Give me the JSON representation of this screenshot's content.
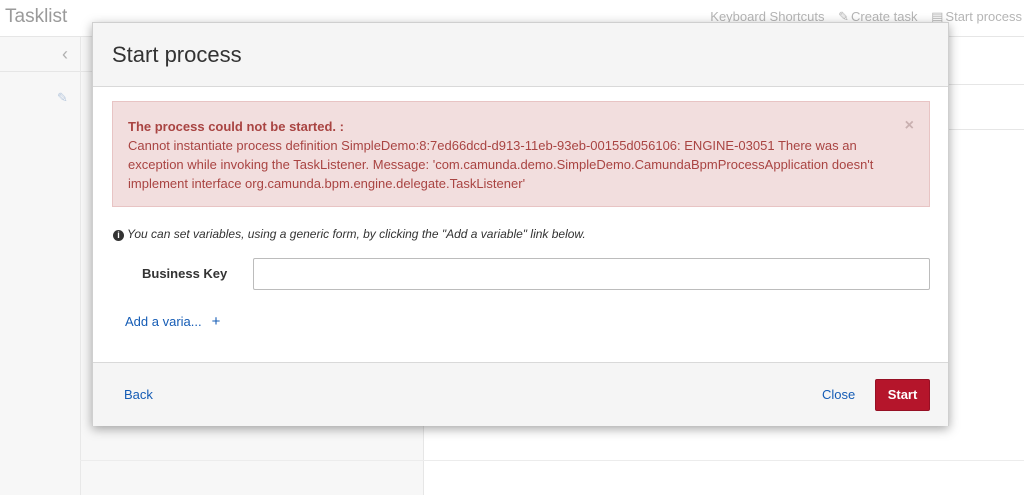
{
  "app": {
    "title": "Tasklist",
    "nav": {
      "shortcuts": "Keyboard Shortcuts",
      "create_task": "Create task",
      "start_process": "Start process"
    }
  },
  "modal": {
    "title": "Start process",
    "alert": {
      "title": "The process could not be started. :",
      "message": "Cannot instantiate process definition SimpleDemo:8:7ed66dcd-d913-11eb-93eb-00155d056106: ENGINE-03051 There was an exception while invoking the TaskListener. Message: 'com.camunda.demo.SimpleDemo.CamundaBpmProcessApplication doesn't implement interface org.camunda.bpm.engine.delegate.TaskListener'",
      "close_glyph": "×"
    },
    "hint": "You can set variables, using a generic form, by clicking the \"Add a variable\" link below.",
    "business_key": {
      "label": "Business Key",
      "value": ""
    },
    "add_variable": {
      "label": "Add a varia...",
      "icon": "+"
    },
    "footer": {
      "back": "Back",
      "close": "Close",
      "start": "Start"
    }
  },
  "colors": {
    "alert_bg": "#f2dede",
    "alert_text": "#a94442",
    "link": "#155cb5",
    "primary_button": "#b5152b"
  }
}
